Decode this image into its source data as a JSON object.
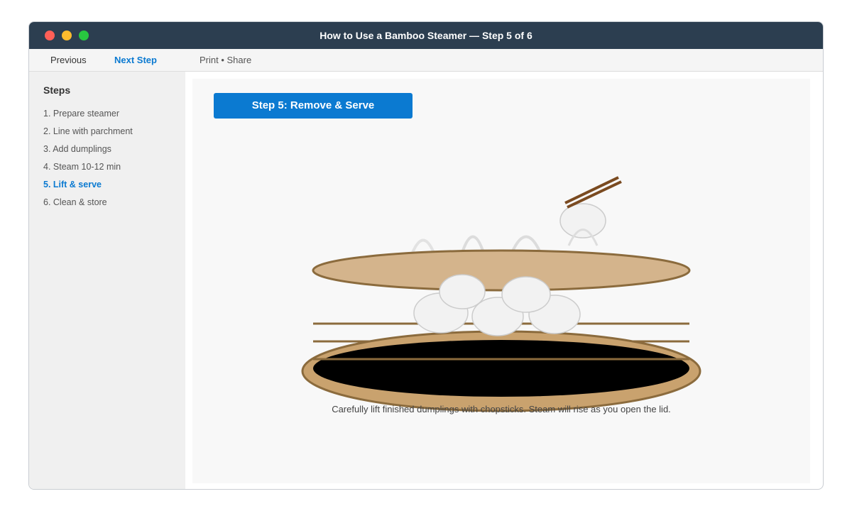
{
  "window": {
    "title": "How to Use a Bamboo Steamer — Step 5 of 6"
  },
  "toolbar": {
    "previous_label": "Previous",
    "next_label": "Next Step",
    "print_share_label": "Print • Share"
  },
  "sidebar": {
    "heading": "Steps",
    "items": [
      {
        "label": "1. Prepare steamer",
        "active": false
      },
      {
        "label": "2. Line with parchment",
        "active": false
      },
      {
        "label": "3. Add dumplings",
        "active": false
      },
      {
        "label": "4. Steam 10-12 min",
        "active": false
      },
      {
        "label": "5. Lift & serve",
        "active": true
      },
      {
        "label": "6. Clean & store",
        "active": false
      }
    ]
  },
  "main": {
    "step_title": "Step 5: Remove & Serve",
    "caption": "Carefully lift finished dumplings with chopsticks. Steam will rise as you open the lid."
  },
  "colors": {
    "titlebar": "#2c3e50",
    "accent": "#0b7ad1",
    "bamboo_light": "#d4b48c",
    "bamboo_dark": "#8b6b3d",
    "chopsticks": "#7a4a20",
    "dumpling_fill": "#f2f2f2",
    "dumpling_stroke": "#cccccc"
  }
}
